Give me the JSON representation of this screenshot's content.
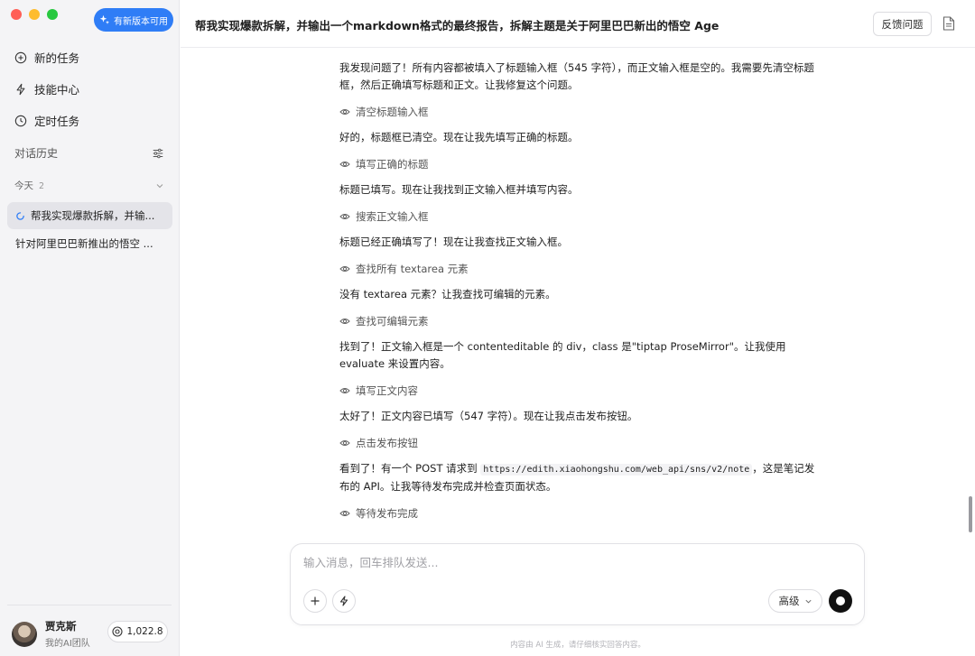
{
  "sidebar": {
    "update_button": "有新版本可用",
    "nav": [
      {
        "label": "新的任务",
        "icon": "plus-icon"
      },
      {
        "label": "技能中心",
        "icon": "bolt-icon"
      },
      {
        "label": "定时任务",
        "icon": "clock-icon"
      }
    ],
    "history_title": "对话历史",
    "today_label": "今天",
    "today_count": "2",
    "conversations": [
      {
        "title": "帮我实现爆款拆解，并输...",
        "active": true
      },
      {
        "title": "针对阿里巴巴新推出的悟空 ...",
        "active": false
      }
    ],
    "user": {
      "name": "贾克斯",
      "team": "我的AI团队"
    },
    "credits": "1,022.8"
  },
  "header": {
    "title": "帮我实现爆款拆解，并输出一个markdown格式的最终报告，拆解主题是关于阿里巴巴新出的悟空 Age",
    "feedback": "反馈问题"
  },
  "messages": {
    "p1": "我发现问题了！所有内容都被填入了标题输入框（545 字符），而正文输入框是空的。我需要先清空标题框，然后正确填写标题和正文。让我修复这个问题。",
    "s1": "清空标题输入框",
    "p2": "好的，标题框已清空。现在让我先填写正确的标题。",
    "s2": "填写正确的标题",
    "p3": "标题已填写。现在让我找到正文输入框并填写内容。",
    "s3": "搜索正文输入框",
    "p4": "标题已经正确填写了！现在让我查找正文输入框。",
    "s4": "查找所有 textarea 元素",
    "p5": "没有 textarea 元素？让我查找可编辑的元素。",
    "s5": "查找可编辑元素",
    "p6": "找到了！正文输入框是一个 contenteditable 的 div，class 是\"tiptap ProseMirror\"。让我使用 evaluate 来设置内容。",
    "s6": "填写正文内容",
    "p7": "太好了！正文内容已填写（547 字符）。现在让我点击发布按钮。",
    "s7": "点击发布按钮",
    "p8_before": "看到了！有一个 POST 请求到 ",
    "p8_code": "https://edith.xiaohongshu.com/web_api/sns/v2/note",
    "p8_after": "，这是笔记发布的 API。让我等待发布完成并检查页面状态。",
    "s8": "等待发布完成"
  },
  "composer": {
    "placeholder": "输入消息，回车排队发送...",
    "mode": "高级"
  },
  "footer_note": "内容由 AI 生成，请仔细核实回答内容。"
}
